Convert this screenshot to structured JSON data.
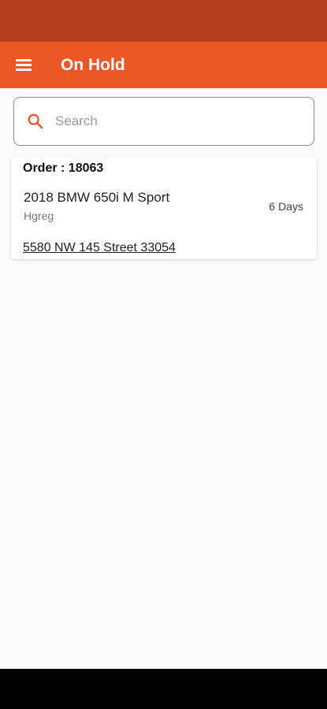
{
  "header": {
    "title": "On Hold",
    "menu_icon": "hamburger-menu-icon",
    "color": "#ec5727",
    "status_bar_color": "#b33f1f"
  },
  "search": {
    "placeholder": "Search",
    "value": "",
    "icon": "search-icon",
    "icon_color": "#e4542a"
  },
  "orders": [
    {
      "order_label": "Order : 18063",
      "vehicle": "2018 BMW 650i M Sport",
      "customer": "Hgreg",
      "days": "6 Days",
      "address": "5580 NW 145 Street 33054"
    }
  ]
}
